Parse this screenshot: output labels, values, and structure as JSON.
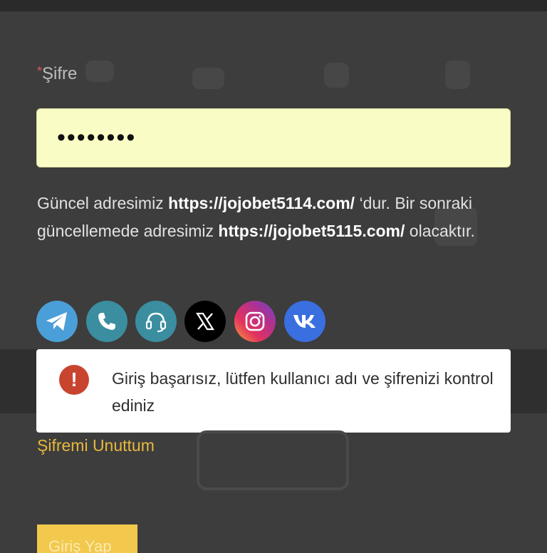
{
  "form": {
    "password_label": "Şifre",
    "required_mark": "*",
    "password_value": "••••••••"
  },
  "notice": {
    "part1": "Güncel adresimiz ",
    "current_url": "https://jojobet5114.com/",
    "part2": " ‘dur. Bir sonraki güncellemede adresimiz ",
    "next_url": "https://jojobet5115.com/",
    "part3": " olacaktır."
  },
  "social": [
    {
      "name": "telegram-icon",
      "color": "#4a9fd8"
    },
    {
      "name": "phone-icon",
      "color": "#3a8ea0"
    },
    {
      "name": "headset-icon",
      "color": "#3a8ea0"
    },
    {
      "name": "x-icon",
      "color": "#000000"
    },
    {
      "name": "instagram-icon",
      "color": "#d6249f"
    },
    {
      "name": "vk-icon",
      "color": "#3a6fe0"
    }
  ],
  "toast": {
    "icon": "error-icon",
    "message": "Giriş başarısız, lütfen kullanıcı adı ve şifrenizi kontrol ediniz"
  },
  "forgot_password": "Şifremi Unuttum",
  "login_button": "Giriş Yap",
  "colors": {
    "accent": "#f2c94c",
    "link": "#e8b83c",
    "error": "#c9442f"
  }
}
